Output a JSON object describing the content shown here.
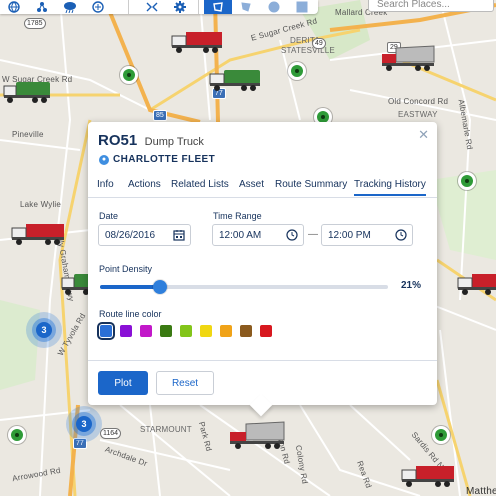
{
  "toolbar": {
    "search_placeholder": "Search Places...",
    "tools": [
      "globe-icon",
      "nodes-icon",
      "weather-icon",
      "layers-icon",
      "route-icon",
      "gear-icon",
      "lasso-icon",
      "polygon-icon",
      "circle-icon",
      "rectangle-icon"
    ]
  },
  "map": {
    "labels": {
      "derita": "DERITA",
      "statesville": "STATESVILLE",
      "eastway": "EASTWAY",
      "starmount": "STARMOUNT",
      "matthews": "Matthe",
      "old_concord": "Old Concord Rd",
      "sugar_creek": "E Sugar Creek Rd",
      "w_sugar_creek": "W Sugar Creek Rd",
      "billy_graham": "Billy Graham Pkwy",
      "w_tyvola": "W Tyvola Rd",
      "archdale": "Archdale Dr",
      "park_rd": "Park Rd",
      "sardis": "Sardis Rd N",
      "sharon": "Sharon Rd",
      "colony": "Colony Rd",
      "rea": "Rea Rd",
      "albemarle": "Albemarle Rd",
      "arrowood": "Arrowood Rd",
      "pineville": "Pineville",
      "lake_wylie": "Lake Wylie",
      "mallard": "Mallard Creek"
    },
    "shields": {
      "i85": "85",
      "i77_top": "77",
      "i77_bottom": "77",
      "us29": "29",
      "nc1785": "1785",
      "nc1164": "1164",
      "nc49": "49"
    },
    "clusters": [
      {
        "count": "3"
      },
      {
        "count": "3"
      }
    ]
  },
  "popup": {
    "id": "RO51",
    "vehicle_type": "Dump Truck",
    "fleet": "CHARLOTTE FLEET",
    "tabs": [
      "Info",
      "Actions",
      "Related Lists",
      "Asset",
      "Route Summary",
      "Tracking History"
    ],
    "active_tab": "Tracking History",
    "date_label": "Date",
    "date_value": "08/26/2016",
    "time_range_label": "Time Range",
    "time_start": "12:00 AM",
    "time_end": "12:00 PM",
    "density_label": "Point Density",
    "density_value": 0.21,
    "density_text": "21%",
    "color_label": "Route line color",
    "colors": [
      "#2a6fd6",
      "#8a10d6",
      "#c218c9",
      "#3a7a12",
      "#83c51a",
      "#f0d712",
      "#f0a318",
      "#8b5a1e",
      "#d8181f"
    ],
    "selected_color": "#2a6fd6",
    "plot_label": "Plot",
    "reset_label": "Reset",
    "close_icon": "close-icon"
  }
}
